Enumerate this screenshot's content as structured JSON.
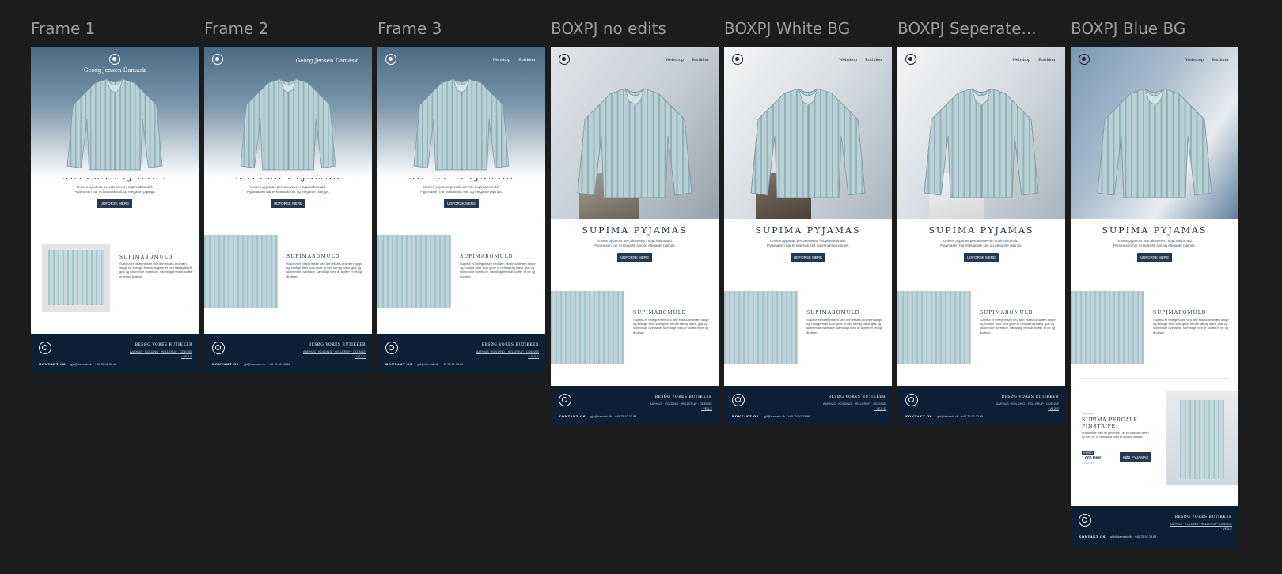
{
  "canvas": {
    "background": "#1c1c1c"
  },
  "frames": [
    {
      "label": "Frame 1"
    },
    {
      "label": "Frame 2"
    },
    {
      "label": "Frame 3"
    },
    {
      "label": "BOXPJ no edits"
    },
    {
      "label": "BOXPJ White BG"
    },
    {
      "label": "BOXPJ Seperate..."
    },
    {
      "label": "BOXPJ Blue BG"
    }
  ],
  "email": {
    "brand": "Georg Jensen Damask",
    "nav": {
      "webshop": "Webshop",
      "stores": "Butikker"
    },
    "hero_title": "SUPIMA PYJAMAS",
    "hero_desc_1": "Unisex pyjamas percalevævet i supimabomuld.",
    "hero_desc_2": "Pyjamasen har et klassisk snit og elegante pipings.",
    "cta": "UDFORSK MERE",
    "section_title": "SUPIMABOMULD",
    "section_desc": "Supima er betegnelsen ved den ekstra-ordinært lange og ensfige fibre som giver et helt særlig blødt, glat og skinnende overflade, samtidigt med at stoffer er let og åndbart.",
    "footer": {
      "visit": "BESØG VORES BUTIKKER",
      "shops": "AARHUS · KOLDING · HELLERUP · ODENSE · VEJLE",
      "contact_label": "KONTAKT OS",
      "contact_info": "gjd@damask.dk · +45 75 52 33 88"
    }
  },
  "product": {
    "category": "Pyjamas",
    "name": "SUPIMA PERCALE PINSTRIPE",
    "desc": "Bright Blue med en pinstripe i fin en klassisk ideen, en helt for et luksuriøst med et mindelt afstige.",
    "badge": "NYHED",
    "price": "1.000 DKK",
    "note": "5 FARVER",
    "buy": "KØB PYJAMAS"
  }
}
